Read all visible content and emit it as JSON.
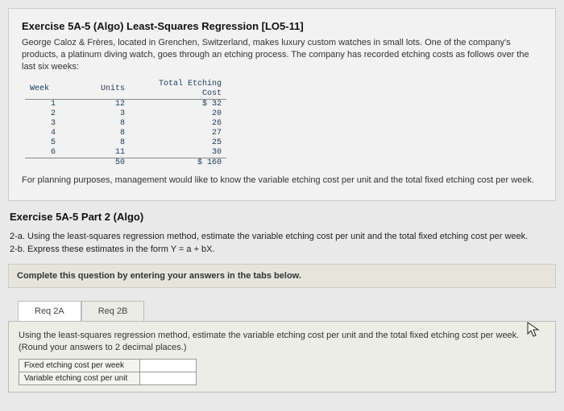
{
  "exercise": {
    "title": "Exercise 5A-5 (Algo) Least-Squares Regression [LO5-11]",
    "intro": "George Caloz & Frères, located in Grenchen, Switzerland, makes luxury custom watches in small lots. One of the company's products, a platinum diving watch, goes through an etching process. The company has recorded etching costs as follows over the last six weeks:",
    "table": {
      "headers": {
        "week": "Week",
        "units": "Units",
        "cost": "Total Etching Cost"
      },
      "rows": [
        {
          "week": "1",
          "units": "12",
          "cost": "$ 32"
        },
        {
          "week": "2",
          "units": "3",
          "cost": "20"
        },
        {
          "week": "3",
          "units": "8",
          "cost": "26"
        },
        {
          "week": "4",
          "units": "8",
          "cost": "27"
        },
        {
          "week": "5",
          "units": "8",
          "cost": "25"
        },
        {
          "week": "6",
          "units": "11",
          "cost": "30"
        }
      ],
      "totals": {
        "units": "50",
        "cost": "$ 160"
      }
    },
    "closing": "For planning purposes, management would like to know the variable etching cost per unit and the total fixed etching cost per week."
  },
  "part2": {
    "title": "Exercise 5A-5 Part 2 (Algo)",
    "q2a": "2-a. Using the least-squares regression method, estimate the variable etching cost per unit and the total fixed etching cost per week.",
    "q2b": "2-b. Express these estimates in the form Y = a + bX.",
    "completeInstr": "Complete this question by entering your answers in the tabs below.",
    "tabs": {
      "a": "Req 2A",
      "b": "Req 2B"
    },
    "panelText": "Using the least-squares regression method, estimate the variable etching cost per unit and the total fixed etching cost per week. (Round your answers to 2 decimal places.)",
    "answerRows": {
      "fixed": "Fixed etching cost per week",
      "variable": "Variable etching cost per unit"
    }
  }
}
